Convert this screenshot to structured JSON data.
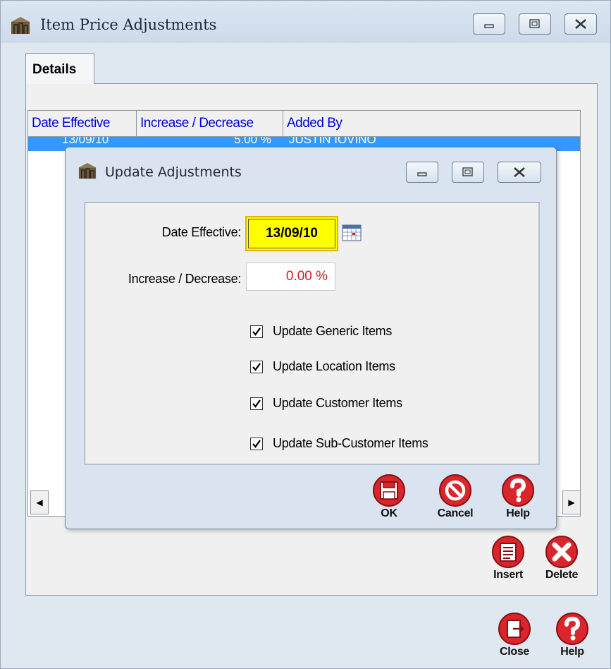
{
  "main_window": {
    "title": "Item Price Adjustments",
    "tab": "Details",
    "grid": {
      "columns": [
        "Date Effective",
        "Increase / Decrease",
        "Added By"
      ],
      "rows": [
        {
          "date_effective": "13/09/10",
          "increase_decrease": "5.00 %",
          "added_by": "JUSTIN IOVINO"
        }
      ]
    },
    "buttons": {
      "insert": "Insert",
      "delete": "Delete",
      "close": "Close",
      "help": "Help"
    }
  },
  "dialog": {
    "title": "Update Adjustments",
    "date_effective_label": "Date Effective:",
    "date_effective_value": "13/09/10",
    "increase_label": "Increase / Decrease:",
    "increase_value": "0.00 %",
    "checkboxes": [
      {
        "label": "Update Generic Items",
        "checked": true
      },
      {
        "label": "Update Location Items",
        "checked": true
      },
      {
        "label": "Update Customer Items",
        "checked": true
      },
      {
        "label": "Update Sub-Customer Items",
        "checked": true
      }
    ],
    "buttons": {
      "ok": "OK",
      "cancel": "Cancel",
      "help": "Help"
    }
  },
  "colors": {
    "accent_blue": "#3399ff",
    "header_text": "#0000d8",
    "date_highlight": "#ffff00",
    "icon_red": "#d9262c",
    "percent_text": "#d02020"
  }
}
